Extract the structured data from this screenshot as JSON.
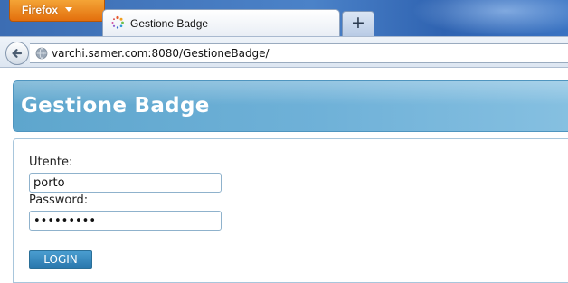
{
  "browser": {
    "menu_button": "Firefox",
    "tab_title": "Gestione Badge",
    "new_tab": "+",
    "url": "varchi.samer.com:8080/GestioneBadge/"
  },
  "page": {
    "title": "Gestione Badge",
    "form": {
      "user_label": "Utente:",
      "user_value": "porto",
      "password_label": "Password:",
      "password_value": "porto1234",
      "login_label": "LOGIN"
    }
  },
  "colors": {
    "header_blue": "#6fb1d8",
    "button_blue": "#2a78ad",
    "firefox_orange": "#e36f0d"
  }
}
